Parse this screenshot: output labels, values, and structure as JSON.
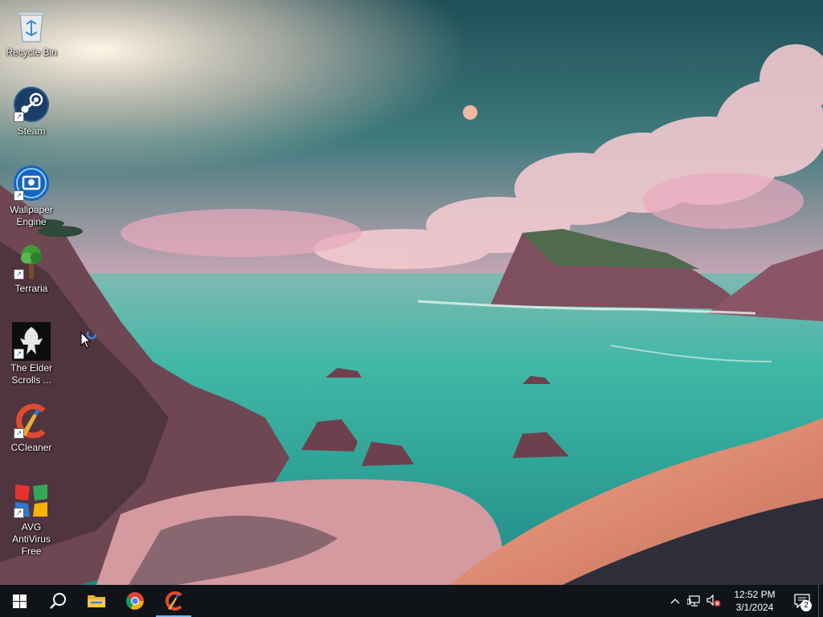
{
  "desktop": {
    "icons": [
      {
        "label": "Recycle Bin",
        "icon": "recycle-bin-icon",
        "shortcut": false
      },
      {
        "label": "Steam",
        "icon": "steam-icon",
        "shortcut": true
      },
      {
        "label": "Wallpaper Engine",
        "icon": "wallpaper-engine-icon",
        "shortcut": true
      },
      {
        "label": "Terraria",
        "icon": "terraria-icon",
        "shortcut": true
      },
      {
        "label": "The Elder Scrolls ...",
        "icon": "elder-scrolls-icon",
        "shortcut": true
      },
      {
        "label": "CCleaner",
        "icon": "ccleaner-icon",
        "shortcut": true
      },
      {
        "label": "AVG AntiVirus Free",
        "icon": "avg-antivirus-icon",
        "shortcut": true
      }
    ]
  },
  "taskbar": {
    "pinned": [
      {
        "name": "start",
        "icon": "windows-logo-icon"
      },
      {
        "name": "search",
        "icon": "search-icon"
      },
      {
        "name": "file-explorer",
        "icon": "folder-icon"
      },
      {
        "name": "chrome",
        "icon": "chrome-icon"
      },
      {
        "name": "ccleaner",
        "icon": "ccleaner-icon",
        "active": true
      }
    ],
    "tray": {
      "icons": [
        "chevron-up-icon",
        "network-icon",
        "volume-muted-icon"
      ],
      "time": "12:52 PM",
      "date": "3/1/2024",
      "notification_count": "2"
    }
  },
  "colors": {
    "taskbar_bg": "#101418",
    "active_indicator": "#76b9ed",
    "sea": "#3fb8a6",
    "sky_top": "#234f57"
  }
}
